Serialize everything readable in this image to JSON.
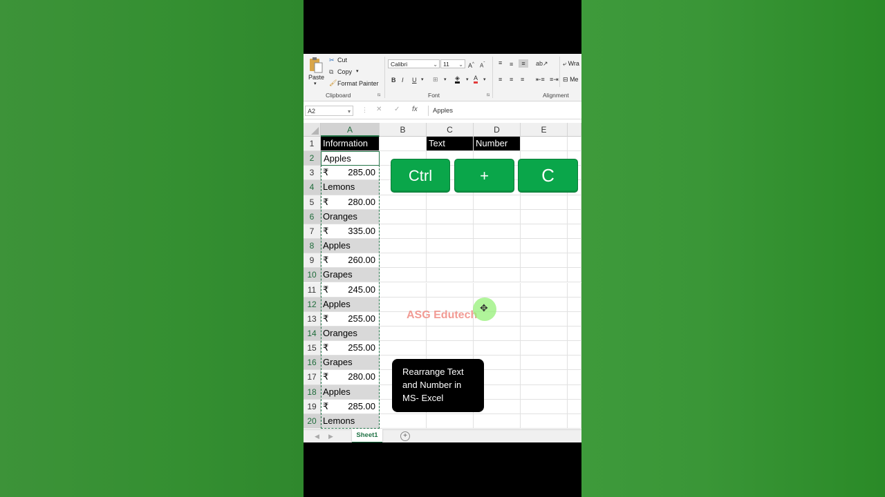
{
  "ribbon": {
    "paste": "Paste",
    "cut": "Cut",
    "copy": "Copy",
    "format_painter": "Format Painter",
    "clipboard_group": "Clipboard",
    "font_name": "Calibri",
    "font_size": "11",
    "font_group": "Font",
    "alignment_group": "Alignment",
    "wrap_text": "Wra",
    "merge": "Me"
  },
  "formula_bar": {
    "name_box": "A2",
    "cancel_glyph": "✕",
    "enter_glyph": "✓",
    "fx": "fx",
    "formula": "Apples"
  },
  "columns": [
    "A",
    "B",
    "C",
    "D",
    "E"
  ],
  "rows": [
    "1",
    "2",
    "3",
    "4",
    "5",
    "6",
    "7",
    "8",
    "9",
    "10",
    "11",
    "12",
    "13",
    "14",
    "15",
    "16",
    "17",
    "18",
    "19",
    "20"
  ],
  "cells": {
    "A1": "Information",
    "C1": "Text",
    "D1": "Number",
    "A_values": [
      {
        "text": "Apples"
      },
      {
        "cur": "₹",
        "num": "285.00"
      },
      {
        "text": "Lemons"
      },
      {
        "cur": "₹",
        "num": "280.00"
      },
      {
        "text": "Oranges"
      },
      {
        "cur": "₹",
        "num": "335.00"
      },
      {
        "text": "Apples"
      },
      {
        "cur": "₹",
        "num": "260.00"
      },
      {
        "text": "Grapes"
      },
      {
        "cur": "₹",
        "num": "245.00"
      },
      {
        "text": "Apples"
      },
      {
        "cur": "₹",
        "num": "255.00"
      },
      {
        "text": "Oranges"
      },
      {
        "cur": "₹",
        "num": "255.00"
      },
      {
        "text": "Grapes"
      },
      {
        "cur": "₹",
        "num": "280.00"
      },
      {
        "text": "Apples"
      },
      {
        "cur": "₹",
        "num": "285.00"
      },
      {
        "text": "Lemons"
      }
    ]
  },
  "keys": [
    "Ctrl",
    "+",
    "C"
  ],
  "watermark": "ASG Edutech",
  "caption": "Rearrange Text and Number in MS- Excel",
  "sheet_tab": "Sheet1",
  "add_sheet": "+",
  "nav_left": "◀",
  "nav_right": "▶",
  "colors": {
    "excel_green": "#217346",
    "key_green": "#0aa64a",
    "background_green": "#2f8c2c"
  }
}
